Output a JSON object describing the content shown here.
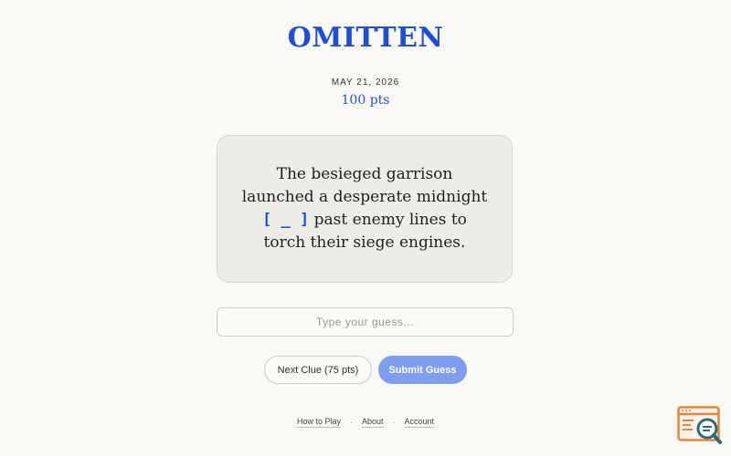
{
  "header": {
    "logo": "OMITTEN",
    "date": "MAY 21, 2026",
    "points": "100 pts"
  },
  "clue": {
    "before": "The besieged garrison launched a desperate midnight",
    "blank": "[ _ ]",
    "after": "past enemy lines to torch their siege engines."
  },
  "guess": {
    "placeholder": "Type your guess...",
    "value": ""
  },
  "buttons": {
    "next_clue": "Next Clue (75 pts)",
    "submit": "Submit Guess"
  },
  "footer": {
    "links": [
      "How to Play",
      "About",
      "Account"
    ],
    "separator": "·"
  },
  "colors": {
    "accent": "#1f4fd6",
    "submit_button": "#7f9ef0",
    "background": "#faf9f6",
    "card": "#eeedea",
    "widget": "#e8843a"
  },
  "icons": {
    "corner_widget": "search-inspect-icon"
  }
}
